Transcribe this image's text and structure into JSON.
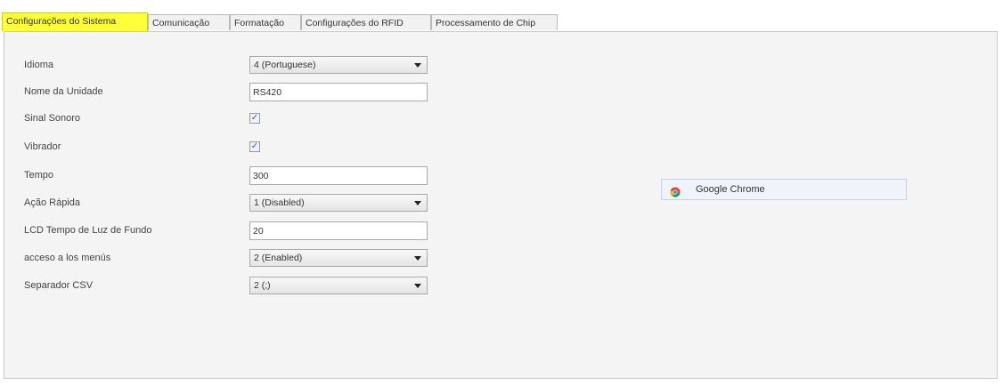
{
  "tabs": [
    {
      "label": "Configurações do Sistema",
      "active": true
    },
    {
      "label": "Comunicação"
    },
    {
      "label": "Formatação"
    },
    {
      "label": "Configurações do RFID"
    },
    {
      "label": "Processamento de Chip"
    }
  ],
  "settings": {
    "idioma": {
      "label": "Idioma",
      "value": "4 (Portuguese)"
    },
    "nome_unidade": {
      "label": "Nome da Unidade",
      "value": "RS420"
    },
    "sinal_sonoro": {
      "label": "Sinal Sonoro",
      "checked": true
    },
    "vibrador": {
      "label": "Vibrador",
      "checked": true
    },
    "tempo": {
      "label": "Tempo",
      "value": "300"
    },
    "acao_rapida": {
      "label": "Ação Rápida",
      "value": "1 (Disabled)"
    },
    "lcd_tempo": {
      "label": "LCD Tempo de Luz de Fundo",
      "value": "20"
    },
    "acceso_menus": {
      "label": "acceso a los menús",
      "value": "2 (Enabled)"
    },
    "separador_csv": {
      "label": "Separador CSV",
      "value": "2 (;)"
    }
  },
  "taskbar_popup": {
    "label": "Google Chrome",
    "icon": "chrome-icon"
  },
  "colors": {
    "active_tab_highlight": "#ffff3a"
  }
}
